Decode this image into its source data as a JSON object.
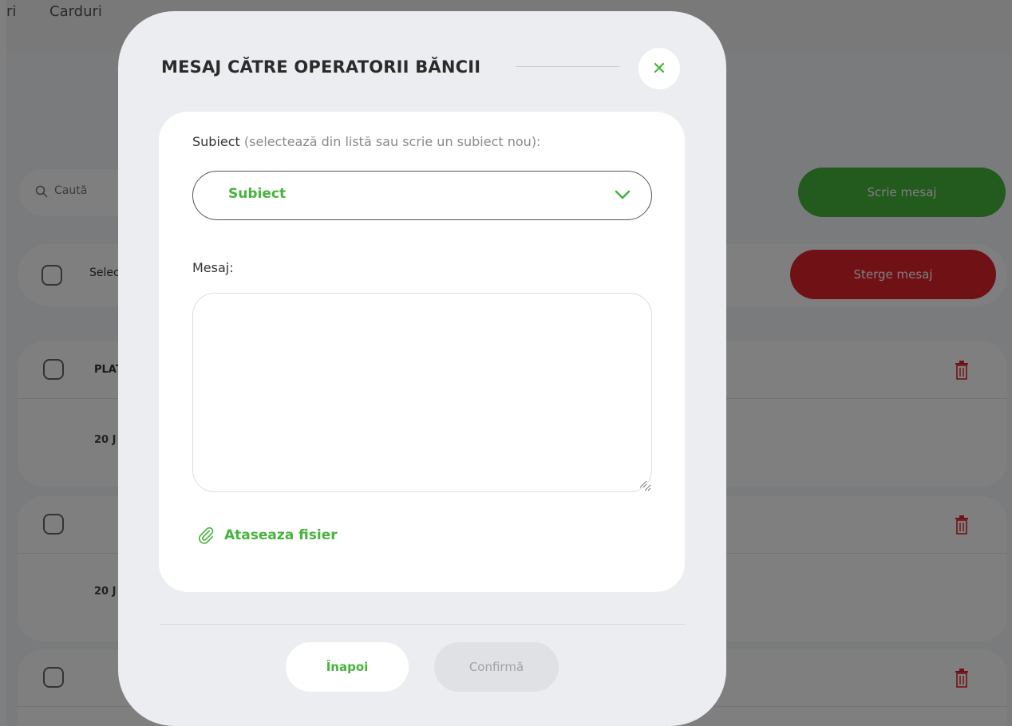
{
  "background": {
    "nav_items": [
      "ri",
      "Carduri"
    ],
    "search_placeholder": "Caută",
    "write_button": "Scrie mesaj",
    "delete_button": "Sterge mesaj",
    "select_label": "Selec",
    "messages": [
      {
        "title": "PLAT",
        "date": "20 J"
      },
      {
        "title": "",
        "date": "20 J"
      },
      {
        "title": "",
        "date": ""
      }
    ]
  },
  "modal": {
    "title": "MESAJ CĂTRE OPERATORII BĂNCII",
    "close_icon": "close-icon",
    "subject_label": "Subiect",
    "subject_hint": "(selectează din listă sau scrie un subiect nou):",
    "subject_value": "Subiect",
    "message_label": "Mesaj:",
    "message_value": "",
    "attach_label": "Ataseaza fisier",
    "back_button": "Înapoi",
    "confirm_button": "Confirmă"
  },
  "colors": {
    "accent_green": "#46b43c",
    "danger_red": "#e0222d",
    "modal_bg": "#ebedf0"
  }
}
